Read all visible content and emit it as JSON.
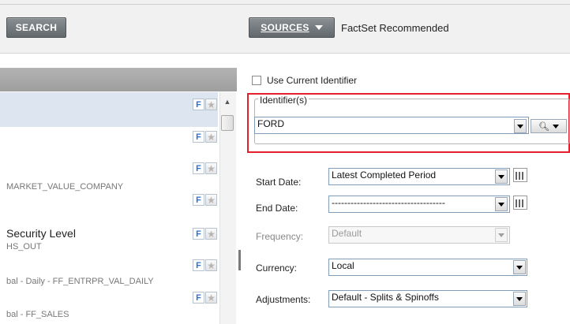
{
  "toolbar": {
    "search_label": "SEARCH",
    "sources_label": "SOURCES",
    "sources_value": "FactSet Recommended"
  },
  "left_list": {
    "items": [
      {
        "title": "",
        "subtitle": ""
      },
      {
        "title": "",
        "subtitle": ""
      },
      {
        "title": "",
        "subtitle": "MARKET_VALUE_COMPANY"
      },
      {
        "title": "",
        "subtitle": ""
      },
      {
        "title": "Security Level",
        "subtitle": "HS_OUT"
      },
      {
        "title": "",
        "subtitle": "bal - Daily - FF_ENTRPR_VAL_DAILY"
      },
      {
        "title": "",
        "subtitle": "bal - FF_SALES"
      }
    ],
    "f_label": "F",
    "star_glyph": "★"
  },
  "form": {
    "use_current_identifier": "Use Current Identifier",
    "identifiers_legend": "Identifier(s)",
    "identifier_value": "FORD",
    "start_date": {
      "label": "Start Date:",
      "value": "Latest Completed Period"
    },
    "end_date": {
      "label": "End Date:",
      "value": "------------------------------------"
    },
    "frequency": {
      "label": "Frequency:",
      "value": "Default"
    },
    "currency": {
      "label": "Currency:",
      "value": "Local"
    },
    "adjustments": {
      "label": "Adjustments:",
      "value": "Default - Splits & Spinoffs"
    }
  },
  "colors": {
    "highlight_border": "#e4202f",
    "selected_row": "#dde5f0"
  }
}
